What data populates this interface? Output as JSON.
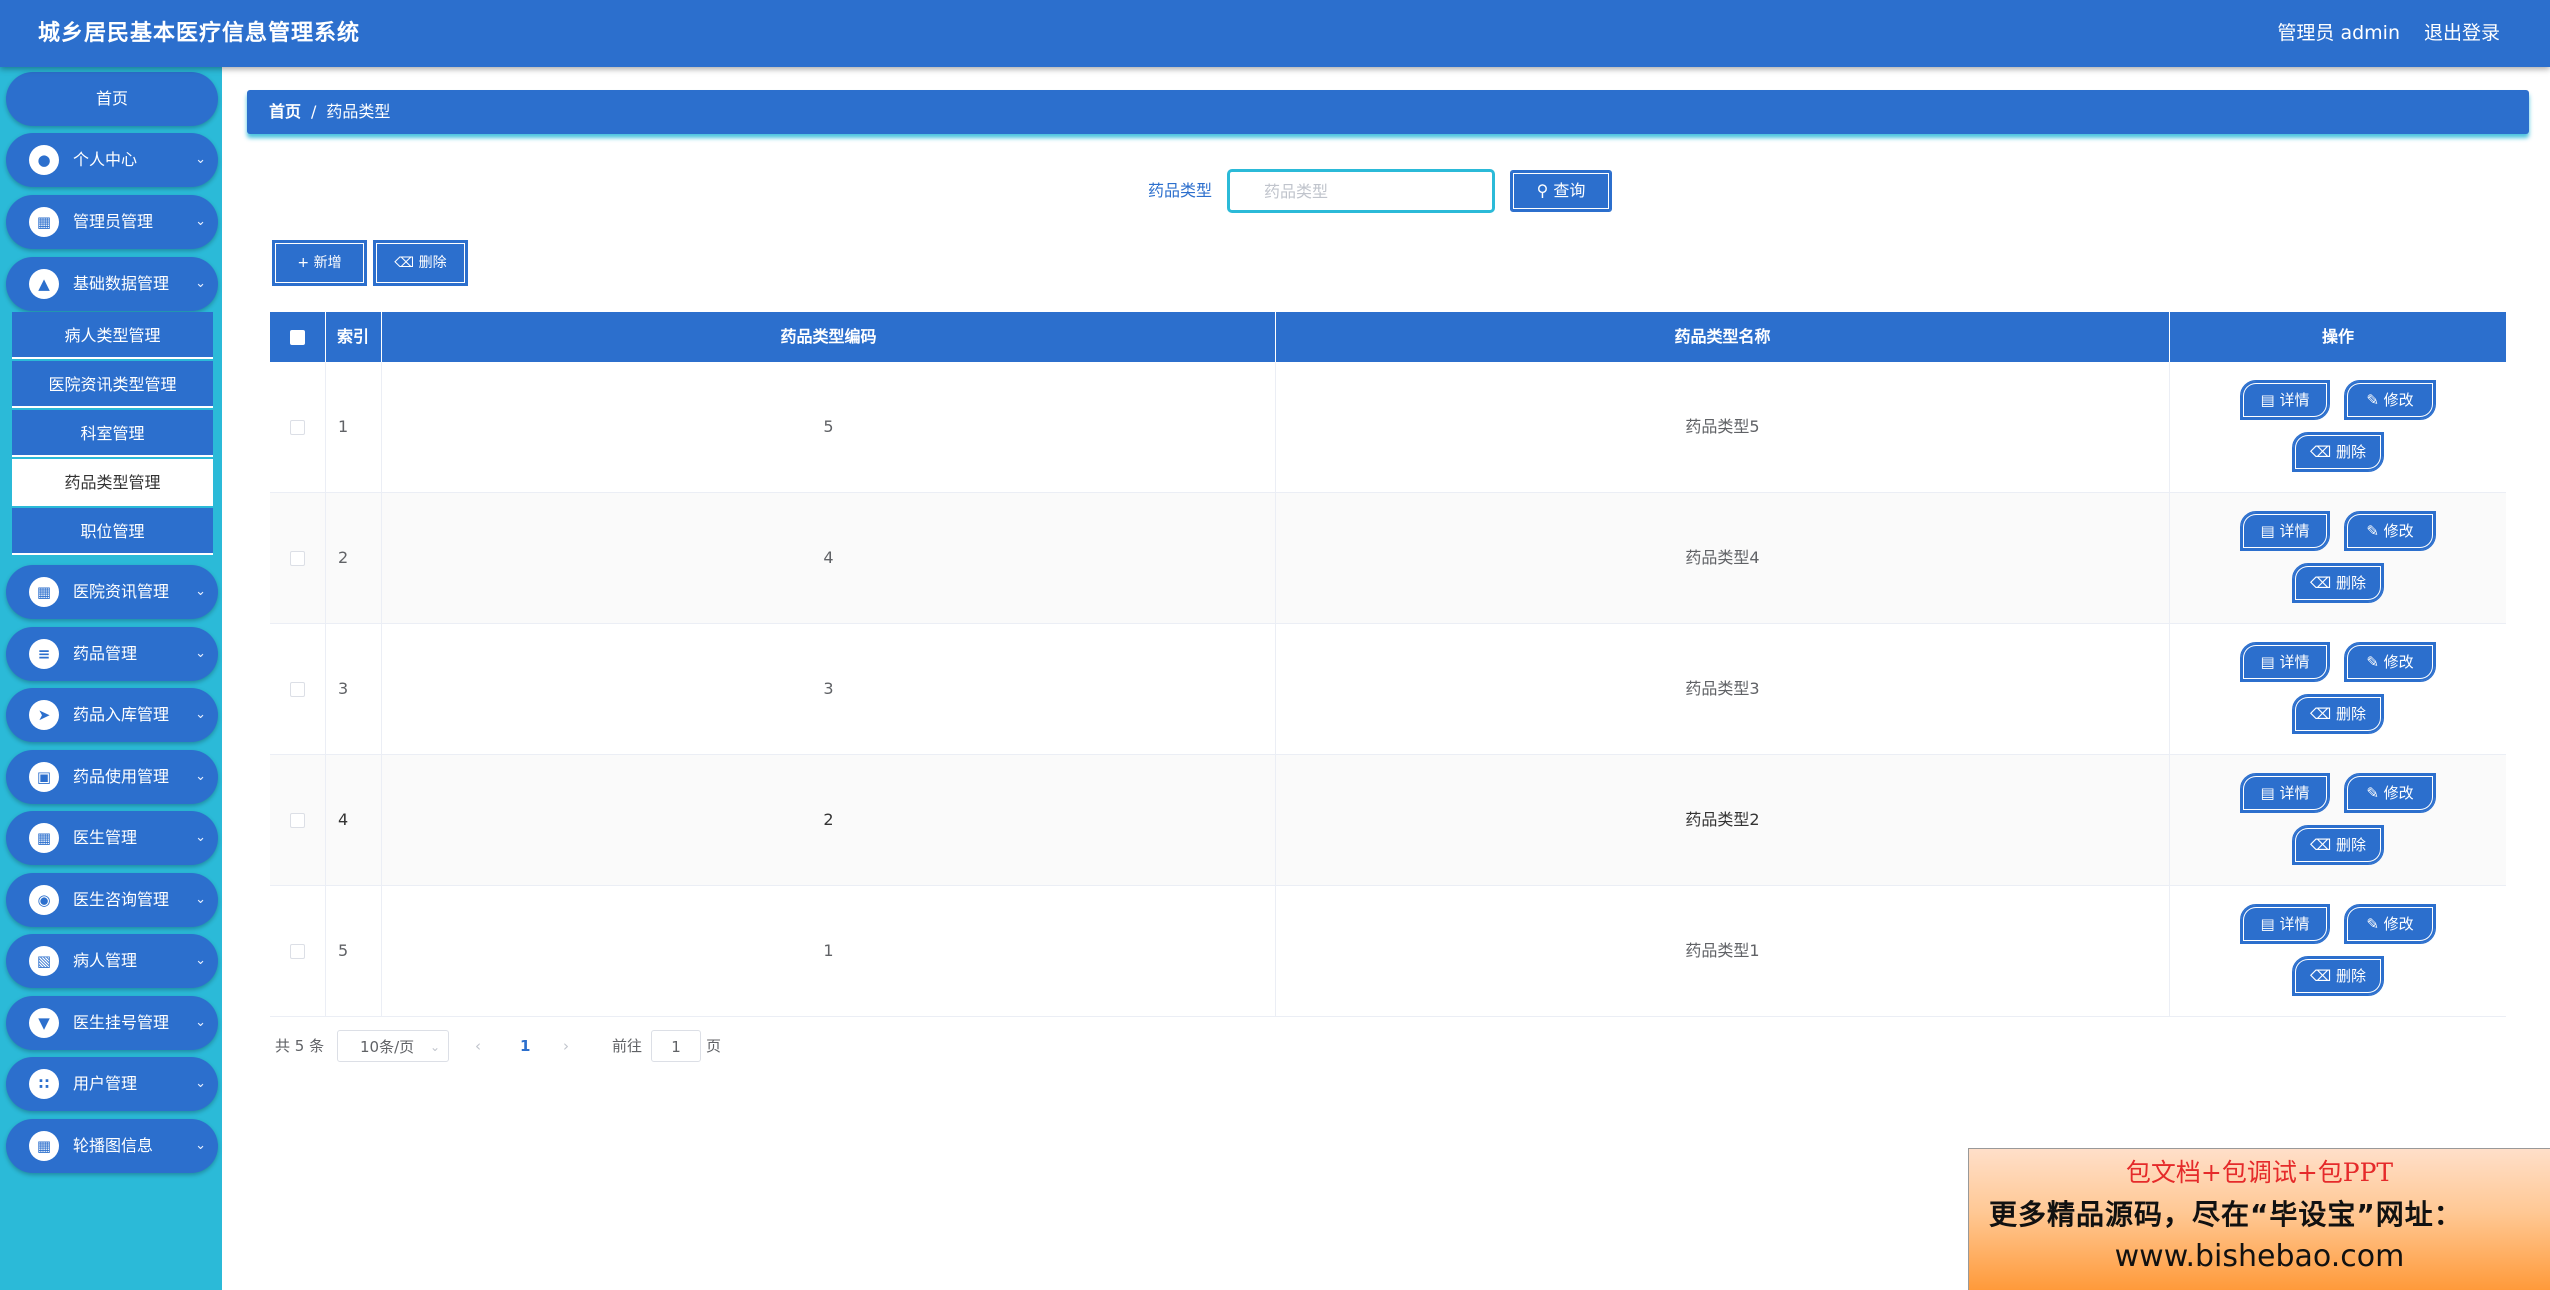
{
  "header": {
    "title": "城乡居民基本医疗信息管理系统",
    "user": "管理员 admin",
    "logout": "退出登录"
  },
  "sidebar": {
    "home": "首页",
    "menus": [
      {
        "label": "个人中心",
        "icon": "user-icon"
      },
      {
        "label": "管理员管理",
        "icon": "book-icon"
      },
      {
        "label": "基础数据管理",
        "icon": "chart-icon"
      },
      {
        "label": "医院资讯管理",
        "icon": "grid-icon"
      },
      {
        "label": "药品管理",
        "icon": "sliders-icon"
      },
      {
        "label": "药品入库管理",
        "icon": "send-icon"
      },
      {
        "label": "药品使用管理",
        "icon": "briefcase-icon"
      },
      {
        "label": "医生管理",
        "icon": "grid-icon"
      },
      {
        "label": "医生咨询管理",
        "icon": "location-icon"
      },
      {
        "label": "病人管理",
        "icon": "clipboard-icon"
      },
      {
        "label": "医生挂号管理",
        "icon": "stamp-icon"
      },
      {
        "label": "用户管理",
        "icon": "apps-icon"
      },
      {
        "label": "轮播图信息",
        "icon": "grid-icon"
      }
    ],
    "submenu": [
      {
        "label": "病人类型管理"
      },
      {
        "label": "医院资讯类型管理"
      },
      {
        "label": "科室管理"
      },
      {
        "label": "药品类型管理"
      },
      {
        "label": "职位管理"
      }
    ]
  },
  "breadcrumb": {
    "home": "首页",
    "separator": "/",
    "current": "药品类型"
  },
  "search": {
    "label": "药品类型",
    "placeholder": "药品类型",
    "button": "查询"
  },
  "toolbar": {
    "add": "新增",
    "delete": "删除"
  },
  "table": {
    "headers": {
      "index": "索引",
      "code": "药品类型编码",
      "name": "药品类型名称",
      "ops": "操作"
    },
    "rows": [
      {
        "index": "1",
        "code": "5",
        "name": "药品类型5"
      },
      {
        "index": "2",
        "code": "4",
        "name": "药品类型4"
      },
      {
        "index": "3",
        "code": "3",
        "name": "药品类型3"
      },
      {
        "index": "4",
        "code": "2",
        "name": "药品类型2"
      },
      {
        "index": "5",
        "code": "1",
        "name": "药品类型1"
      }
    ],
    "actions": {
      "detail": "详情",
      "edit": "修改",
      "delete": "删除"
    }
  },
  "pager": {
    "total": "共 5 条",
    "page_size": "10条/页",
    "current": "1",
    "goto": "前往",
    "goto_value": "1",
    "unit": "页"
  },
  "promo": {
    "line1": "包文档+包调试+包PPT",
    "line2": "更多精品源码，尽在“毕设宝”网址：",
    "line3": "www.bishebao.com"
  },
  "colors": {
    "primary": "#2c6fcd",
    "sidebar": "#2bbad8"
  }
}
